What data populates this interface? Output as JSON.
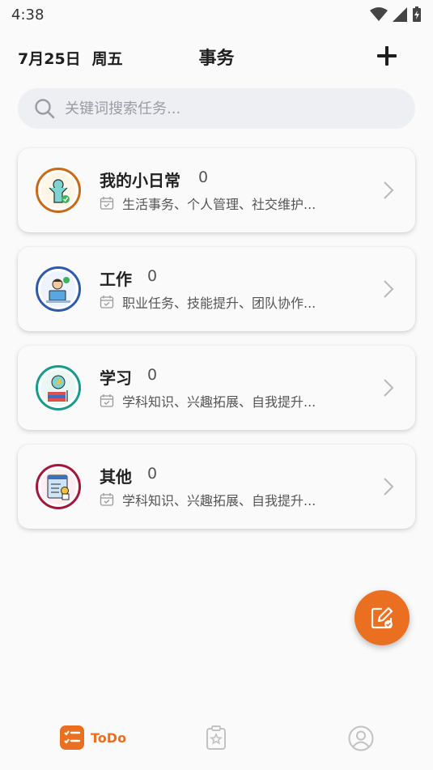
{
  "status": {
    "time": "4:38"
  },
  "header": {
    "date": "7月25日",
    "weekday": "周五",
    "title": "事务"
  },
  "search": {
    "placeholder": "关键词搜索任务..."
  },
  "categories": [
    {
      "title": "我的小日常",
      "count": "0",
      "subtitle": "生活事务、个人管理、社交维护...",
      "ring_color": "#c96a1a"
    },
    {
      "title": "工作",
      "count": "0",
      "subtitle": "职业任务、技能提升、团队协作...",
      "ring_color": "#2f5aa8"
    },
    {
      "title": "学习",
      "count": "0",
      "subtitle": "学科知识、兴趣拓展、自我提升...",
      "ring_color": "#1a9a8a"
    },
    {
      "title": "其他",
      "count": "0",
      "subtitle": "学科知识、兴趣拓展、自我提升...",
      "ring_color": "#a2183a"
    }
  ],
  "tabs": [
    {
      "label": "ToDo",
      "icon": "todo-list-icon",
      "active": true
    },
    {
      "label": "",
      "icon": "clipboard-star-icon",
      "active": false
    },
    {
      "label": "",
      "icon": "profile-icon",
      "active": false
    }
  ],
  "colors": {
    "accent": "#ea6f21",
    "search_bg": "#eeeff3"
  }
}
